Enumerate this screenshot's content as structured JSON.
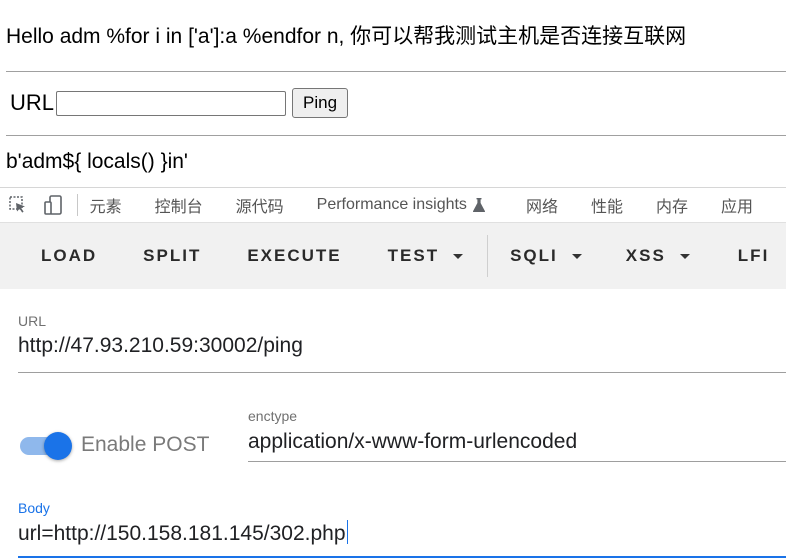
{
  "page": {
    "greeting": "Hello adm %for i in ['a']:a %endfor n, 你可以帮我测试主机是否连接互联网",
    "url_label": "URL",
    "url_input_value": "",
    "ping_button": "Ping",
    "output": "b'adm${ locals() }in'"
  },
  "devtools": {
    "tabs": [
      "元素",
      "控制台",
      "源代码",
      "Performance insights",
      "网络",
      "性能",
      "内存",
      "应用"
    ],
    "icons": [
      "inspect-cursor-icon",
      "device-toolbar-icon",
      "flask-icon"
    ]
  },
  "hackbar": {
    "buttons": {
      "load": "LOAD",
      "split": "SPLIT",
      "execute": "EXECUTE",
      "test": "TEST",
      "sqli": "SQLI",
      "xss": "XSS",
      "lfi": "LFI"
    },
    "url_label": "URL",
    "url_value": "http://47.93.210.59:30002/ping",
    "enable_post_label": "Enable POST",
    "enable_post_checked": true,
    "enctype_label": "enctype",
    "enctype_value": "application/x-www-form-urlencoded",
    "body_label": "Body",
    "body_value": "url=http://150.158.181.145/302.php"
  },
  "colors": {
    "accent": "#1a73e8",
    "toggle_track": "#8fb8ec",
    "toolbar_bg": "#f1f1f1"
  }
}
